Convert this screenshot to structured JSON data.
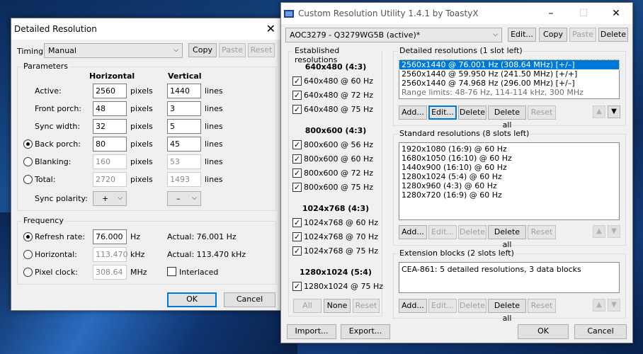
{
  "detailed_dialog": {
    "title": "Detailed Resolution",
    "timing_label": "Timing:",
    "timing_value": "Manual",
    "copy": "Copy",
    "paste": "Paste",
    "reset": "Reset",
    "parameters_label": "Parameters",
    "horizontal": "Horizontal",
    "vertical": "Vertical",
    "rows": [
      {
        "label": "Active:",
        "h": "2560",
        "hu": "pixels",
        "v": "1440",
        "vu": "lines"
      },
      {
        "label": "Front porch:",
        "h": "48",
        "hu": "pixels",
        "v": "3",
        "vu": "lines"
      },
      {
        "label": "Sync width:",
        "h": "32",
        "hu": "pixels",
        "v": "5",
        "vu": "lines"
      },
      {
        "label": "Back porch:",
        "h": "80",
        "hu": "pixels",
        "v": "45",
        "vu": "lines"
      },
      {
        "label": "Blanking:",
        "h": "160",
        "hu": "pixels",
        "v": "53",
        "vu": "lines"
      },
      {
        "label": "Total:",
        "h": "2720",
        "hu": "pixels",
        "v": "1493",
        "vu": "lines"
      }
    ],
    "sync_polarity_label": "Sync polarity:",
    "h_polarity": "+",
    "v_polarity": "–",
    "frequency_label": "Frequency",
    "refresh_label": "Refresh rate:",
    "refresh_value": "76.000",
    "refresh_unit": "Hz",
    "refresh_actual": "Actual: 76.001 Hz",
    "horizontal_label": "Horizontal:",
    "horizontal_value": "113.470",
    "horizontal_unit": "kHz",
    "horizontal_actual": "Actual: 113.470 kHz",
    "pixel_label": "Pixel clock:",
    "pixel_value": "308.64",
    "pixel_unit": "MHz",
    "interlaced": "Interlaced",
    "ok": "OK",
    "cancel": "Cancel"
  },
  "cru": {
    "title": "Custom Resolution Utility 1.4.1 by ToastyX",
    "monitor": "AOC3279 - Q3279WG5B (active)*",
    "edit": "Edit...",
    "copy": "Copy",
    "paste": "Paste",
    "delete": "Delete",
    "established_label": "Established resolutions",
    "est_groups": [
      {
        "header": "640x480 (4:3)",
        "items": [
          "640x480 @ 60 Hz",
          "640x480 @ 72 Hz",
          "640x480 @ 75 Hz"
        ]
      },
      {
        "header": "800x600 (4:3)",
        "items": [
          "800x600 @ 56 Hz",
          "800x600 @ 60 Hz",
          "800x600 @ 72 Hz",
          "800x600 @ 75 Hz"
        ]
      },
      {
        "header": "1024x768 (4:3)",
        "items": [
          "1024x768 @ 60 Hz",
          "1024x768 @ 70 Hz",
          "1024x768 @ 75 Hz"
        ]
      },
      {
        "header": "1280x1024 (5:4)",
        "items": [
          "1280x1024 @ 75 Hz"
        ]
      }
    ],
    "all": "All",
    "none": "None",
    "reset": "Reset",
    "detailed_label": "Detailed resolutions (1 slot left)",
    "detailed_items": [
      "2560x1440 @ 76.001 Hz (308.64 MHz) [+/–]",
      "2560x1440 @ 59.950 Hz (241.50 MHz) [+/+]",
      "2560x1440 @ 74.968 Hz (296.00 MHz) [+/–]",
      "Range limits: 48-76 Hz, 114-114 kHz, 300 MHz"
    ],
    "standard_label": "Standard resolutions (8 slots left)",
    "standard_items": [
      "1920x1080 (16:9) @ 60 Hz",
      "1680x1050 (16:10) @ 60 Hz",
      "1440x900 (16:10) @ 60 Hz",
      "1280x1024 (5:4) @ 60 Hz",
      "1280x960 (4:3) @ 60 Hz",
      "1280x720 (16:9) @ 60 Hz"
    ],
    "extension_label": "Extension blocks (2 slots left)",
    "extension_items": [
      "CEA-861: 5 detailed resolutions, 3 data blocks"
    ],
    "add": "Add...",
    "edit2": "Edit...",
    "delete2": "Delete",
    "delete_all": "Delete all",
    "reset2": "Reset",
    "import": "Import...",
    "export": "Export...",
    "ok": "OK",
    "cancel": "Cancel"
  }
}
